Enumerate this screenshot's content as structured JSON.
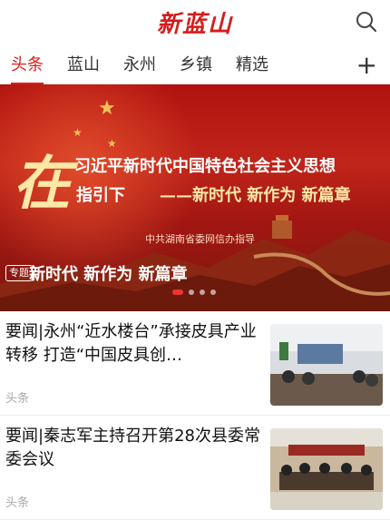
{
  "header": {
    "logo_text": "新蓝山"
  },
  "tabs": [
    {
      "label": "头条",
      "active": true
    },
    {
      "label": "蓝山"
    },
    {
      "label": "永州"
    },
    {
      "label": "乡镇"
    },
    {
      "label": "精选"
    }
  ],
  "banner": {
    "big_char": "在",
    "line1": "习近平新时代中国特色社会主义思想",
    "line2a": "指引下",
    "line2b": "——新时代 新作为 新篇章",
    "sub": "中共湖南省委网信办指导",
    "tag": "专题",
    "title": "新时代 新作为 新篇章"
  },
  "news": [
    {
      "title": "要闻|永州“近水楼台”承接皮具产业转移 打造“中国皮具创…",
      "source": "头条"
    },
    {
      "title": "要闻|秦志军主持召开第28次县委常委会议",
      "source": "头条"
    }
  ]
}
